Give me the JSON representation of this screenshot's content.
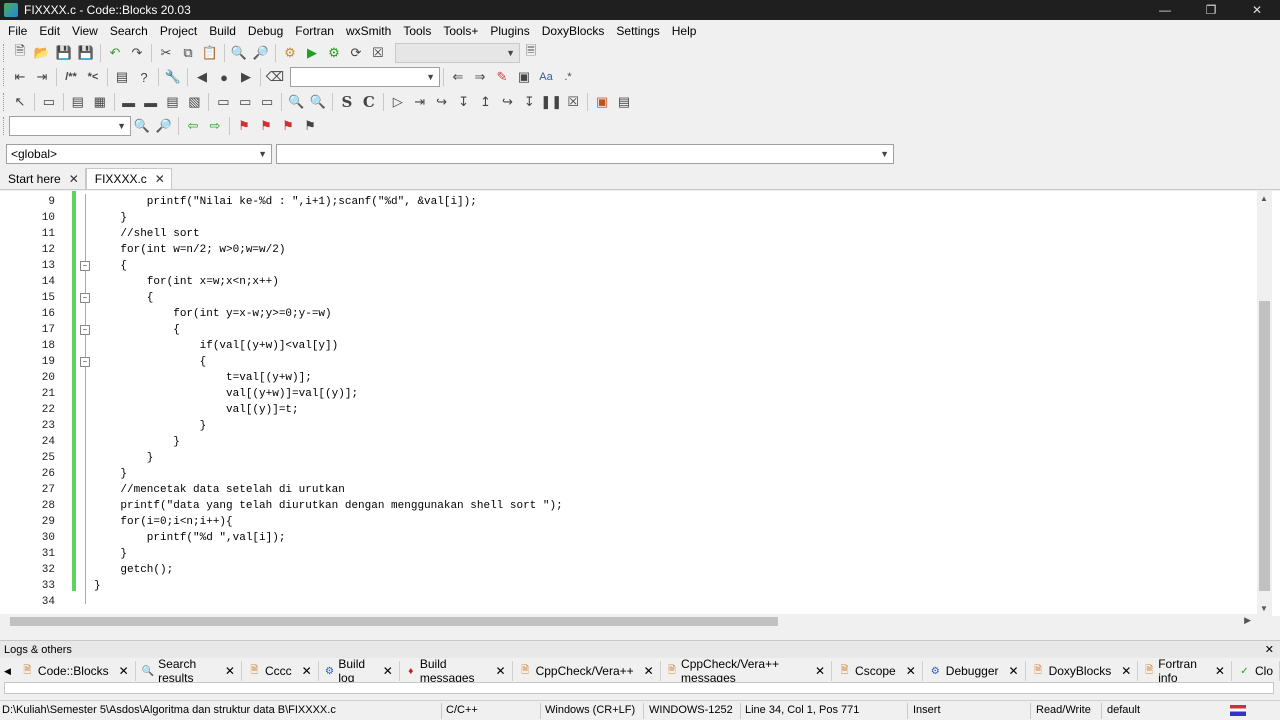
{
  "window": {
    "title": "FIXXXX.c - Code::Blocks 20.03"
  },
  "menu": [
    "File",
    "Edit",
    "View",
    "Search",
    "Project",
    "Build",
    "Debug",
    "Fortran",
    "wxSmith",
    "Tools",
    "Tools+",
    "Plugins",
    "DoxyBlocks",
    "Settings",
    "Help"
  ],
  "scope": {
    "left": "<global>",
    "right": ""
  },
  "tabs": [
    {
      "label": "Start here",
      "active": false
    },
    {
      "label": "FIXXXX.c",
      "active": true
    }
  ],
  "editor": {
    "lines": [
      {
        "n": "9",
        "code": "        printf(\"Nilai ke-%d : \",i+1);scanf(\"%d\", &val[i]);"
      },
      {
        "n": "10",
        "code": "    }"
      },
      {
        "n": "11",
        "code": "    //shell sort"
      },
      {
        "n": "12",
        "code": "    for(int w=n/2; w>0;w=w/2)"
      },
      {
        "n": "13",
        "code": "    {"
      },
      {
        "n": "14",
        "code": "        for(int x=w;x<n;x++)"
      },
      {
        "n": "15",
        "code": "        {"
      },
      {
        "n": "16",
        "code": "            for(int y=x-w;y>=0;y-=w)"
      },
      {
        "n": "17",
        "code": "            {"
      },
      {
        "n": "18",
        "code": "                if(val[(y+w)]<val[y])"
      },
      {
        "n": "19",
        "code": "                {"
      },
      {
        "n": "20",
        "code": "                    t=val[(y+w)];"
      },
      {
        "n": "21",
        "code": "                    val[(y+w)]=val[(y)];"
      },
      {
        "n": "22",
        "code": "                    val[(y)]=t;"
      },
      {
        "n": "23",
        "code": "                }"
      },
      {
        "n": "24",
        "code": "            }"
      },
      {
        "n": "25",
        "code": "        }"
      },
      {
        "n": "26",
        "code": "    }"
      },
      {
        "n": "27",
        "code": "    //mencetak data setelah di urutkan"
      },
      {
        "n": "28",
        "code": "    printf(\"data yang telah diurutkan dengan menggunakan shell sort \");"
      },
      {
        "n": "29",
        "code": "    for(i=0;i<n;i++){"
      },
      {
        "n": "30",
        "code": "        printf(\"%d \",val[i]);"
      },
      {
        "n": "31",
        "code": "    }"
      },
      {
        "n": "32",
        "code": "    getch();"
      },
      {
        "n": "33",
        "code": "}"
      },
      {
        "n": "34",
        "code": ""
      }
    ]
  },
  "logs": {
    "title": "Logs & others",
    "tabs": [
      "Code::Blocks",
      "Search results",
      "Cccc",
      "Build log",
      "Build messages",
      "CppCheck/Vera++",
      "CppCheck/Vera++ messages",
      "Cscope",
      "Debugger",
      "DoxyBlocks",
      "Fortran info",
      "Clo"
    ]
  },
  "status": {
    "path": "D:\\Kuliah\\Semester 5\\Asdos\\Algoritma dan struktur data B\\FIXXXX.c",
    "language": "C/C++",
    "eol": "Windows (CR+LF)",
    "encoding": "WINDOWS-1252",
    "position": "Line 34, Col 1, Pos 771",
    "mode": "Insert",
    "access": "Read/Write",
    "theme": "default"
  }
}
